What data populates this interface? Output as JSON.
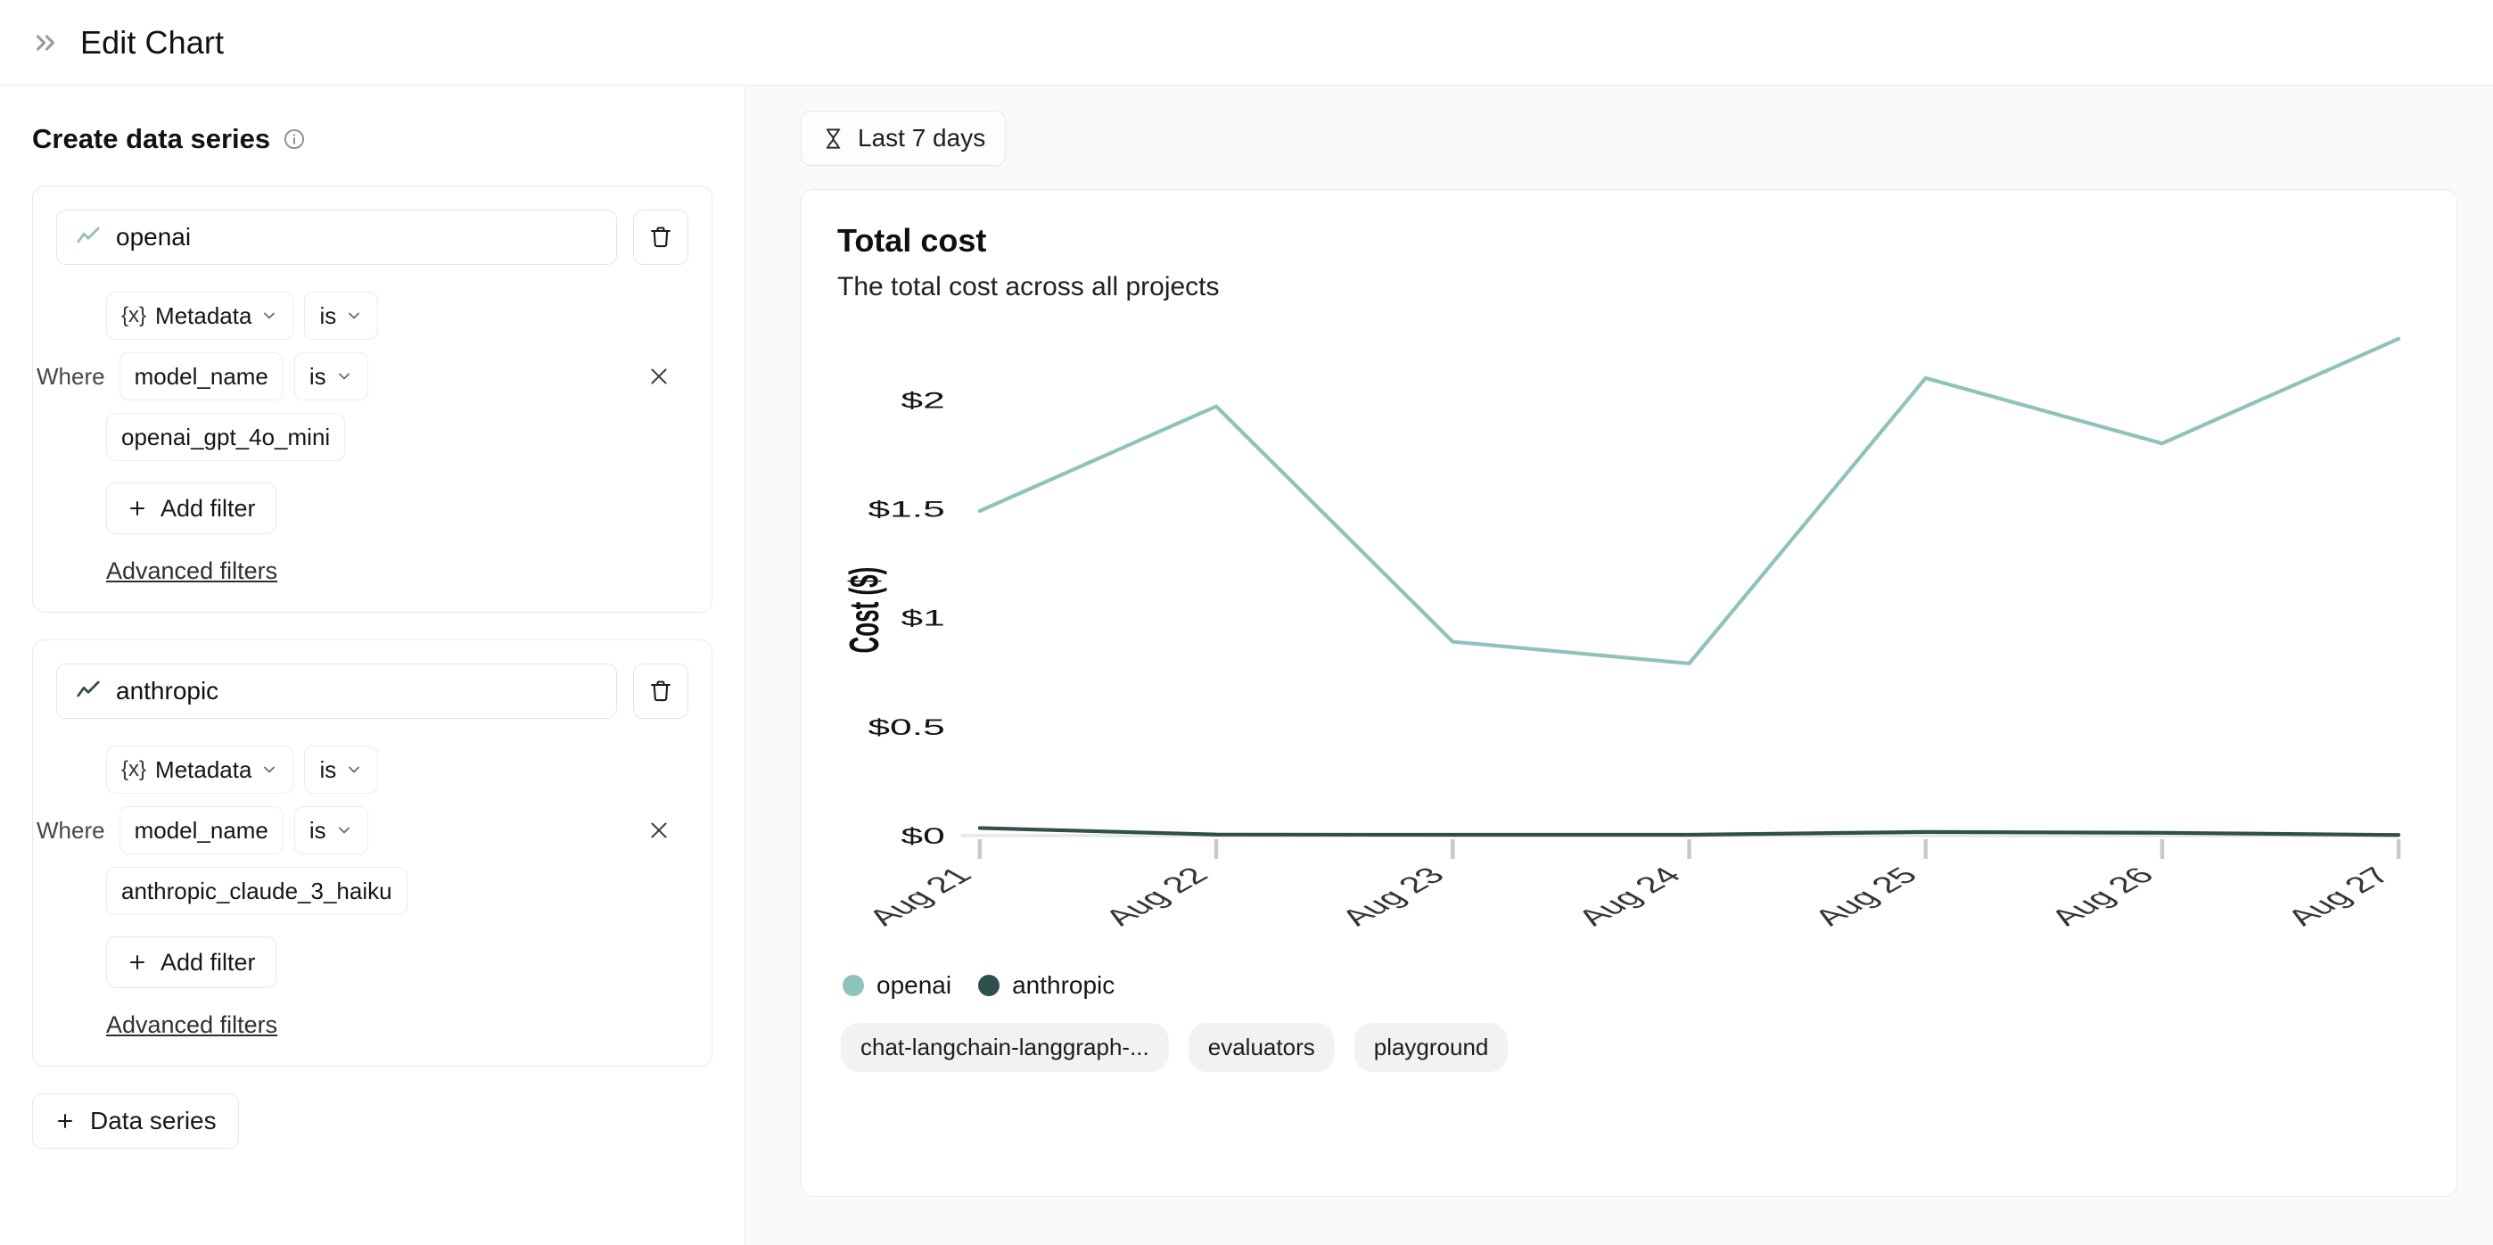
{
  "header": {
    "collapse_icon": "chevrons-right-icon",
    "title": "Edit Chart"
  },
  "sidebar": {
    "section_title": "Create data series",
    "info_icon": "info-icon",
    "add_series_label": "Data series",
    "series": [
      {
        "name": "openai",
        "line_icon": "line-chart-icon",
        "line_color": "#8fc2bc",
        "delete_icon": "trash-icon",
        "field_chip": "Metadata",
        "field_icon": "{x}",
        "field_operator": "is",
        "where_label": "Where",
        "key_chip": "model_name",
        "key_operator": "is",
        "value_chip": "openai_gpt_4o_mini",
        "remove_filter_icon": "close-icon",
        "add_filter_label": "Add filter",
        "advanced_filters_label": "Advanced filters"
      },
      {
        "name": "anthropic",
        "line_icon": "line-chart-icon",
        "line_color": "#2e4f4c",
        "delete_icon": "trash-icon",
        "field_chip": "Metadata",
        "field_icon": "{x}",
        "field_operator": "is",
        "where_label": "Where",
        "key_chip": "model_name",
        "key_operator": "is",
        "value_chip": "anthropic_claude_3_haiku",
        "remove_filter_icon": "close-icon",
        "add_filter_label": "Add filter",
        "advanced_filters_label": "Advanced filters"
      }
    ]
  },
  "preview": {
    "date_range_label": "Last 7 days",
    "date_range_icon": "hourglass-icon",
    "tags": [
      "chat-langchain-langgraph-...",
      "evaluators",
      "playground"
    ]
  },
  "chart_data": {
    "type": "line",
    "title": "Total cost",
    "subtitle": "The total cost across all projects",
    "xlabel": "",
    "ylabel": "Cost ($)",
    "x": [
      "Aug 21",
      "Aug 22",
      "Aug 23",
      "Aug 24",
      "Aug 25",
      "Aug 26",
      "Aug 27"
    ],
    "ylim": [
      0,
      2.3
    ],
    "yticks": [
      0,
      0.5,
      1,
      1.5,
      2
    ],
    "ytick_labels": [
      "$0",
      "$0.5",
      "$1",
      "$1.5",
      "$2"
    ],
    "grid": false,
    "legend_position": "bottom-left",
    "series": [
      {
        "name": "openai",
        "color": "#8fc2bc",
        "values": [
          1.49,
          1.97,
          0.89,
          0.79,
          2.1,
          1.8,
          2.28
        ]
      },
      {
        "name": "anthropic",
        "color": "#2e4f4c",
        "values": [
          0.035,
          0.005,
          0.004,
          0.004,
          0.017,
          0.013,
          0.003
        ]
      }
    ]
  }
}
